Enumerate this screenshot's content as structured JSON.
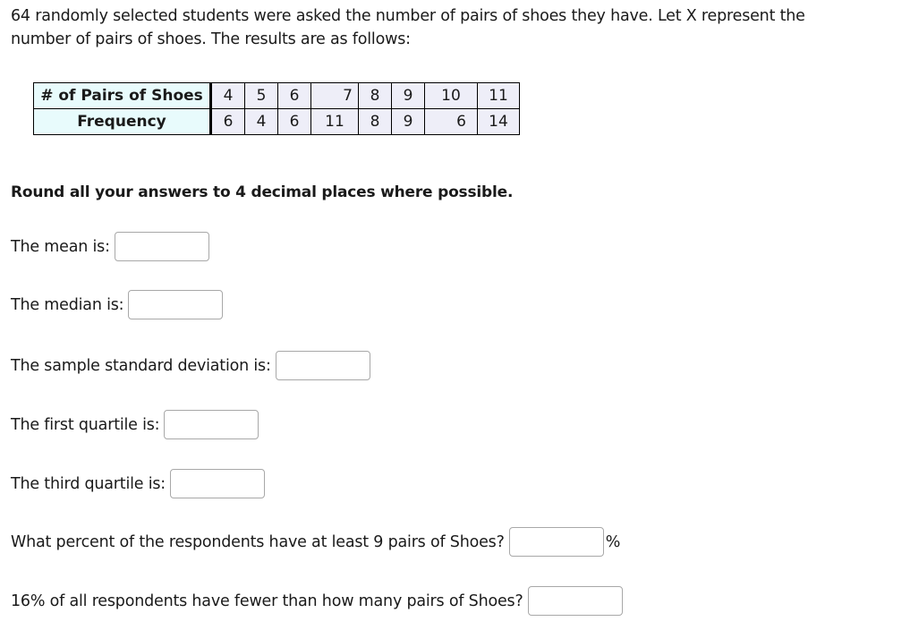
{
  "intro_text": "64 randomly selected students were asked the number of pairs of shoes they have. Let X represent the number of pairs of shoes. The results are as follows:",
  "table": {
    "row_headers": [
      "# of Pairs of Shoes",
      "Frequency"
    ],
    "x_values": [
      "4",
      "5",
      "6",
      "7",
      "8",
      "9",
      "10",
      "11"
    ],
    "frequencies": [
      "6",
      "4",
      "6",
      "11",
      "8",
      "9",
      "6",
      "14"
    ]
  },
  "round_note": "Round all your answers to 4 decimal places where possible.",
  "questions": [
    {
      "label": "The mean is:",
      "value": ""
    },
    {
      "label": "The median is:",
      "value": ""
    },
    {
      "label": "The sample standard deviation is:",
      "value": ""
    },
    {
      "label": "The first quartile is:",
      "value": ""
    },
    {
      "label": "The third quartile is:",
      "value": ""
    },
    {
      "label": "What percent of the respondents have at least 9 pairs of Shoes?",
      "value": "",
      "suffix": "%"
    },
    {
      "label": "16% of all respondents have fewer than how many pairs of Shoes?",
      "value": ""
    }
  ]
}
